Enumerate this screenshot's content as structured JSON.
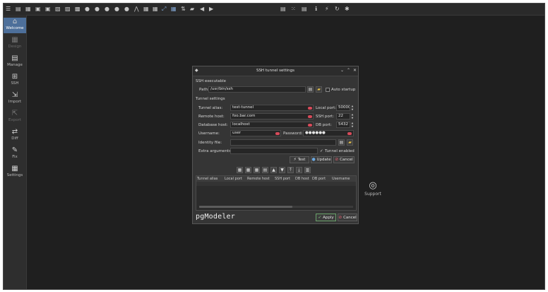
{
  "toolbar": {
    "icons": [
      "hamburger-icon",
      "new-file-icon",
      "open-file-icon",
      "save-icon",
      "save-all-icon",
      "print-icon",
      "print-preview-icon",
      "print-setup-icon",
      "zoom-in-icon",
      "zoom-out-icon",
      "zoom-reset-icon",
      "zoom-fit-icon",
      "grid-icon",
      "align-icon",
      "layers-icon",
      "edit-icon",
      "select-icon",
      "delete-icon",
      "left-arrow-icon",
      "right-arrow-icon",
      "doc-icon",
      "expand-icon",
      "list-icon",
      "info-icon",
      "flash-icon",
      "refresh-icon",
      "plugin-icon"
    ]
  },
  "sidebar": {
    "items": [
      {
        "label": "Welcome",
        "icon": "home-icon",
        "state": "active"
      },
      {
        "label": "Design",
        "icon": "design-icon",
        "state": "disabled"
      },
      {
        "label": "Manage",
        "icon": "manage-icon",
        "state": "normal"
      },
      {
        "label": "SSH",
        "icon": "ssh-icon",
        "state": "normal"
      },
      {
        "label": "Import",
        "icon": "import-icon",
        "state": "normal"
      },
      {
        "label": "Export",
        "icon": "export-icon",
        "state": "disabled"
      },
      {
        "label": "Diff",
        "icon": "diff-icon",
        "state": "normal"
      },
      {
        "label": "Fix",
        "icon": "fix-icon",
        "state": "normal"
      },
      {
        "label": "Settings",
        "icon": "settings-icon",
        "state": "normal"
      }
    ]
  },
  "support": {
    "label": "Support"
  },
  "dialog": {
    "title": "SSH tunnel settings",
    "ssh_section": "SSH executable",
    "path_label": "Path:",
    "path_value": "/usr/bin/ssh",
    "auto_startup_label": "Auto startup",
    "tunnel_section": "Tunnel settings",
    "tunnel_alias_label": "Tunnel alias:",
    "tunnel_alias_value": "test-tunnel",
    "local_port_label": "Local port:",
    "local_port_value": "50000",
    "remote_host_label": "Remote host:",
    "remote_host_value": "foo.bar.com",
    "ssh_port_label": "SSH port:",
    "ssh_port_value": "22",
    "database_host_label": "Database host:",
    "database_host_value": "localhost",
    "db_port_label": "DB port:",
    "db_port_value": "5432",
    "username_label": "Username:",
    "username_value": "user",
    "password_label": "Password:",
    "password_value": "●●●●●●",
    "identity_file_label": "Identity file:",
    "identity_file_value": "",
    "extra_args_label": "Extra arguments:",
    "extra_args_value": "",
    "tunnel_enabled_label": "Tunnel enabled",
    "test_button": "Test",
    "update_button": "Update",
    "cancel_small_button": "Cancel",
    "table_columns": [
      "Tunnel alias",
      "Local port",
      "Remote host",
      "SSH port",
      "DB host",
      "DB port",
      "Username"
    ],
    "logo_text": "pgModeler",
    "apply_button": "Apply",
    "cancel_button": "Cancel"
  }
}
